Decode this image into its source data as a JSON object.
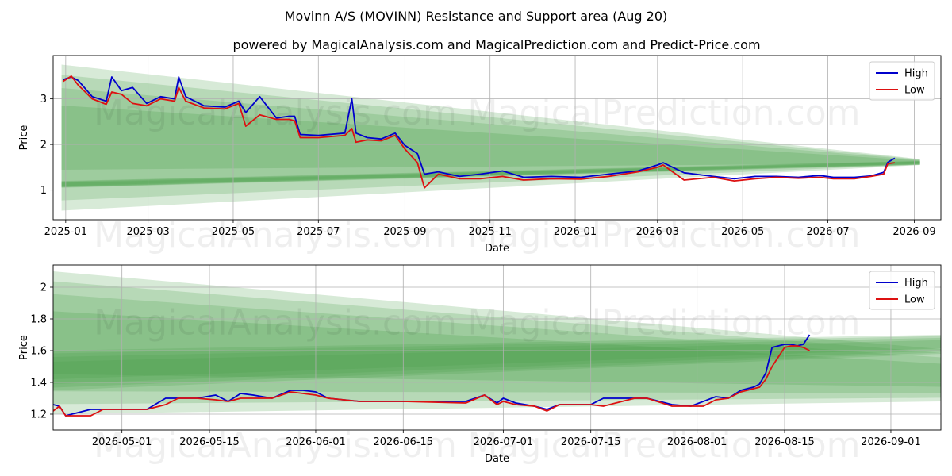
{
  "title": "Movinn A/S (MOVINN) Resistance and Support area (Aug 20)",
  "subtitle": "powered by MagicalAnalysis.com and MagicalPrediction.com and Predict-Price.com",
  "watermarks": [
    "MagicalAnalysis.com",
    "MagicalPrediction.com"
  ],
  "colors": {
    "high": "#0000cc",
    "low": "#dd1111",
    "band": "#4a9e4a",
    "grid": "#b0b0b0"
  },
  "chart_data": [
    {
      "type": "line",
      "xlabel": "Date",
      "ylabel": "Price",
      "grid": true,
      "legend": "top-right",
      "xlim": [
        "2024-12-23",
        "2026-09-20"
      ],
      "ylim": [
        0.35,
        3.95
      ],
      "x_ticks": [
        "2025-01",
        "2025-03",
        "2025-05",
        "2025-07",
        "2025-09",
        "2025-11",
        "2026-01",
        "2026-03",
        "2026-05",
        "2026-07",
        "2026-09"
      ],
      "y_ticks": [
        1,
        2,
        3
      ],
      "band_range": [
        "2024-12-29",
        "2026-09-05"
      ],
      "resistance_band": {
        "start": [
          0.55,
          3.75
        ],
        "end": [
          1.55,
          1.68
        ]
      },
      "support_band": {
        "start": [
          1.05,
          1.2
        ],
        "end": [
          1.55,
          1.64
        ]
      },
      "series": [
        {
          "name": "High",
          "x": [
            "2024-12-30",
            "2025-01-05",
            "2025-01-10",
            "2025-01-20",
            "2025-01-30",
            "2025-02-03",
            "2025-02-10",
            "2025-02-18",
            "2025-02-28",
            "2025-03-10",
            "2025-03-20",
            "2025-03-23",
            "2025-03-28",
            "2025-04-10",
            "2025-04-25",
            "2025-05-05",
            "2025-05-10",
            "2025-05-20",
            "2025-06-01",
            "2025-06-10",
            "2025-06-14",
            "2025-06-18",
            "2025-07-01",
            "2025-07-20",
            "2025-07-25",
            "2025-07-28",
            "2025-08-05",
            "2025-08-15",
            "2025-08-25",
            "2025-09-01",
            "2025-09-10",
            "2025-09-15",
            "2025-09-25",
            "2025-10-10",
            "2025-10-25",
            "2025-11-10",
            "2025-11-25",
            "2025-12-15",
            "2026-01-05",
            "2026-01-25",
            "2026-02-15",
            "2026-03-01",
            "2026-03-05",
            "2026-03-20",
            "2026-04-10",
            "2026-04-25",
            "2026-05-10",
            "2026-05-25",
            "2026-06-10",
            "2026-06-25",
            "2026-07-05",
            "2026-07-20",
            "2026-08-01",
            "2026-08-10",
            "2026-08-13",
            "2026-08-18"
          ],
          "y": [
            3.42,
            3.48,
            3.4,
            3.05,
            2.95,
            3.48,
            3.18,
            3.25,
            2.9,
            3.05,
            3.0,
            3.48,
            3.05,
            2.85,
            2.82,
            2.95,
            2.7,
            3.05,
            2.58,
            2.62,
            2.62,
            2.22,
            2.2,
            2.25,
            3.0,
            2.25,
            2.15,
            2.12,
            2.25,
            1.98,
            1.8,
            1.35,
            1.4,
            1.3,
            1.35,
            1.42,
            1.28,
            1.3,
            1.28,
            1.35,
            1.42,
            1.55,
            1.6,
            1.38,
            1.3,
            1.25,
            1.3,
            1.3,
            1.28,
            1.32,
            1.28,
            1.28,
            1.31,
            1.39,
            1.61,
            1.7
          ]
        },
        {
          "name": "Low",
          "x": [
            "2024-12-30",
            "2025-01-05",
            "2025-01-10",
            "2025-01-20",
            "2025-01-30",
            "2025-02-03",
            "2025-02-10",
            "2025-02-18",
            "2025-02-28",
            "2025-03-10",
            "2025-03-20",
            "2025-03-23",
            "2025-03-28",
            "2025-04-10",
            "2025-04-25",
            "2025-05-05",
            "2025-05-10",
            "2025-05-20",
            "2025-06-01",
            "2025-06-10",
            "2025-06-14",
            "2025-06-18",
            "2025-07-01",
            "2025-07-20",
            "2025-07-25",
            "2025-07-28",
            "2025-08-05",
            "2025-08-15",
            "2025-08-25",
            "2025-09-01",
            "2025-09-10",
            "2025-09-15",
            "2025-09-25",
            "2025-10-10",
            "2025-10-25",
            "2025-11-10",
            "2025-11-25",
            "2025-12-15",
            "2026-01-05",
            "2026-01-25",
            "2026-02-15",
            "2026-03-01",
            "2026-03-05",
            "2026-03-20",
            "2026-04-10",
            "2026-04-25",
            "2026-05-10",
            "2026-05-25",
            "2026-06-10",
            "2026-06-25",
            "2026-07-05",
            "2026-07-20",
            "2026-08-01",
            "2026-08-10",
            "2026-08-13",
            "2026-08-18"
          ],
          "y": [
            3.38,
            3.5,
            3.3,
            3.0,
            2.88,
            3.15,
            3.1,
            2.9,
            2.85,
            3.0,
            2.95,
            3.25,
            2.95,
            2.8,
            2.78,
            2.9,
            2.4,
            2.65,
            2.55,
            2.55,
            2.52,
            2.15,
            2.15,
            2.2,
            2.35,
            2.05,
            2.1,
            2.08,
            2.2,
            1.9,
            1.6,
            1.05,
            1.35,
            1.25,
            1.25,
            1.3,
            1.22,
            1.25,
            1.24,
            1.3,
            1.4,
            1.5,
            1.55,
            1.22,
            1.28,
            1.2,
            1.25,
            1.28,
            1.26,
            1.28,
            1.25,
            1.25,
            1.3,
            1.35,
            1.58,
            1.6
          ]
        }
      ]
    },
    {
      "type": "line",
      "xlabel": "Date",
      "ylabel": "Price",
      "grid": true,
      "legend": "top-right",
      "xlim": [
        "2026-04-20",
        "2026-09-09"
      ],
      "ylim": [
        1.1,
        2.14
      ],
      "x_ticks": [
        "2026-05-01",
        "2026-05-15",
        "2026-06-01",
        "2026-06-15",
        "2026-07-01",
        "2026-07-15",
        "2026-08-01",
        "2026-08-15",
        "2026-09-01"
      ],
      "y_ticks": [
        1.2,
        1.4,
        1.6,
        1.8,
        2.0
      ],
      "band_range": [
        "2026-04-20",
        "2026-09-09"
      ],
      "resistance_band": {
        "start": [
          1.2,
          2.1
        ],
        "end": [
          1.28,
          1.61
        ]
      },
      "support_band": {
        "start": [
          1.35,
          1.6
        ],
        "end": [
          1.58,
          1.7
        ]
      },
      "series": [
        {
          "name": "High",
          "x": [
            "2026-04-20",
            "2026-04-21",
            "2026-04-22",
            "2026-04-24",
            "2026-04-26",
            "2026-04-28",
            "2026-05-01",
            "2026-05-05",
            "2026-05-08",
            "2026-05-10",
            "2026-05-13",
            "2026-05-16",
            "2026-05-18",
            "2026-05-20",
            "2026-05-22",
            "2026-05-25",
            "2026-05-28",
            "2026-05-30",
            "2026-06-01",
            "2026-06-03",
            "2026-06-08",
            "2026-06-15",
            "2026-06-25",
            "2026-06-28",
            "2026-06-30",
            "2026-07-01",
            "2026-07-03",
            "2026-07-06",
            "2026-07-08",
            "2026-07-10",
            "2026-07-15",
            "2026-07-17",
            "2026-07-22",
            "2026-07-24",
            "2026-07-28",
            "2026-07-31",
            "2026-08-02",
            "2026-08-04",
            "2026-08-06",
            "2026-08-08",
            "2026-08-10",
            "2026-08-11",
            "2026-08-12",
            "2026-08-13",
            "2026-08-15",
            "2026-08-16",
            "2026-08-17",
            "2026-08-18",
            "2026-08-19"
          ],
          "y": [
            1.26,
            1.25,
            1.19,
            1.21,
            1.23,
            1.23,
            1.23,
            1.23,
            1.3,
            1.3,
            1.3,
            1.32,
            1.28,
            1.33,
            1.32,
            1.3,
            1.35,
            1.35,
            1.34,
            1.3,
            1.28,
            1.28,
            1.28,
            1.32,
            1.27,
            1.3,
            1.27,
            1.25,
            1.23,
            1.26,
            1.26,
            1.3,
            1.3,
            1.3,
            1.26,
            1.25,
            1.28,
            1.31,
            1.3,
            1.35,
            1.37,
            1.39,
            1.46,
            1.62,
            1.64,
            1.64,
            1.63,
            1.64,
            1.7
          ]
        },
        {
          "name": "Low",
          "x": [
            "2026-04-20",
            "2026-04-21",
            "2026-04-22",
            "2026-04-24",
            "2026-04-26",
            "2026-04-28",
            "2026-05-01",
            "2026-05-05",
            "2026-05-08",
            "2026-05-10",
            "2026-05-13",
            "2026-05-16",
            "2026-05-18",
            "2026-05-20",
            "2026-05-22",
            "2026-05-25",
            "2026-05-28",
            "2026-05-30",
            "2026-06-01",
            "2026-06-03",
            "2026-06-08",
            "2026-06-15",
            "2026-06-25",
            "2026-06-28",
            "2026-06-30",
            "2026-07-01",
            "2026-07-03",
            "2026-07-06",
            "2026-07-08",
            "2026-07-10",
            "2026-07-15",
            "2026-07-17",
            "2026-07-22",
            "2026-07-24",
            "2026-07-28",
            "2026-07-31",
            "2026-08-02",
            "2026-08-04",
            "2026-08-06",
            "2026-08-08",
            "2026-08-10",
            "2026-08-11",
            "2026-08-12",
            "2026-08-13",
            "2026-08-15",
            "2026-08-16",
            "2026-08-17",
            "2026-08-18",
            "2026-08-19"
          ],
          "y": [
            1.22,
            1.25,
            1.19,
            1.19,
            1.19,
            1.23,
            1.23,
            1.23,
            1.26,
            1.3,
            1.3,
            1.29,
            1.28,
            1.3,
            1.3,
            1.3,
            1.34,
            1.33,
            1.32,
            1.3,
            1.28,
            1.28,
            1.27,
            1.32,
            1.26,
            1.28,
            1.26,
            1.25,
            1.22,
            1.26,
            1.26,
            1.25,
            1.3,
            1.3,
            1.25,
            1.25,
            1.25,
            1.29,
            1.3,
            1.34,
            1.36,
            1.37,
            1.42,
            1.5,
            1.62,
            1.63,
            1.63,
            1.62,
            1.6
          ]
        }
      ]
    }
  ]
}
